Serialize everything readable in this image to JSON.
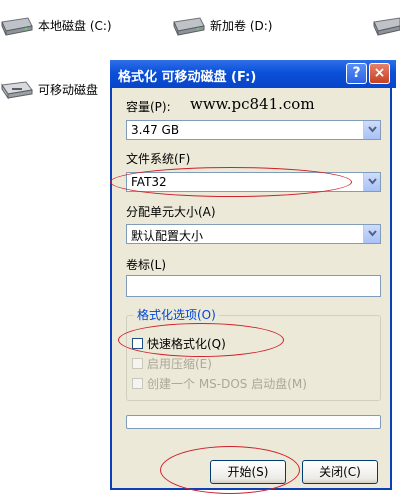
{
  "desktop": {
    "drives": [
      {
        "label": "本地磁盘 (C:)"
      },
      {
        "label": "新加卷 (D:)"
      },
      {
        "label": "可移动磁盘"
      }
    ]
  },
  "dialog": {
    "title": "格式化 可移动磁盘 (F:)",
    "help_button": "?",
    "close_button": "×",
    "watermark": "www.pc841.com",
    "capacity": {
      "label": "容量(P):",
      "value": "3.47 GB"
    },
    "filesystem": {
      "label": "文件系统(F)",
      "value": "FAT32"
    },
    "allocation": {
      "label": "分配单元大小(A)",
      "value": "默认配置大小"
    },
    "volume": {
      "label": "卷标(L)",
      "value": ""
    },
    "options": {
      "title": "格式化选项(O)",
      "quick_format": "快速格式化(Q)",
      "compression": "启用压缩(E)",
      "msdos": "创建一个 MS-DOS 启动盘(M)"
    },
    "start_button": "开始(S)",
    "close_btn_label": "关闭(C)"
  },
  "colors": {
    "annotation": "#d0202a",
    "titlebar": "#0a50d8"
  }
}
